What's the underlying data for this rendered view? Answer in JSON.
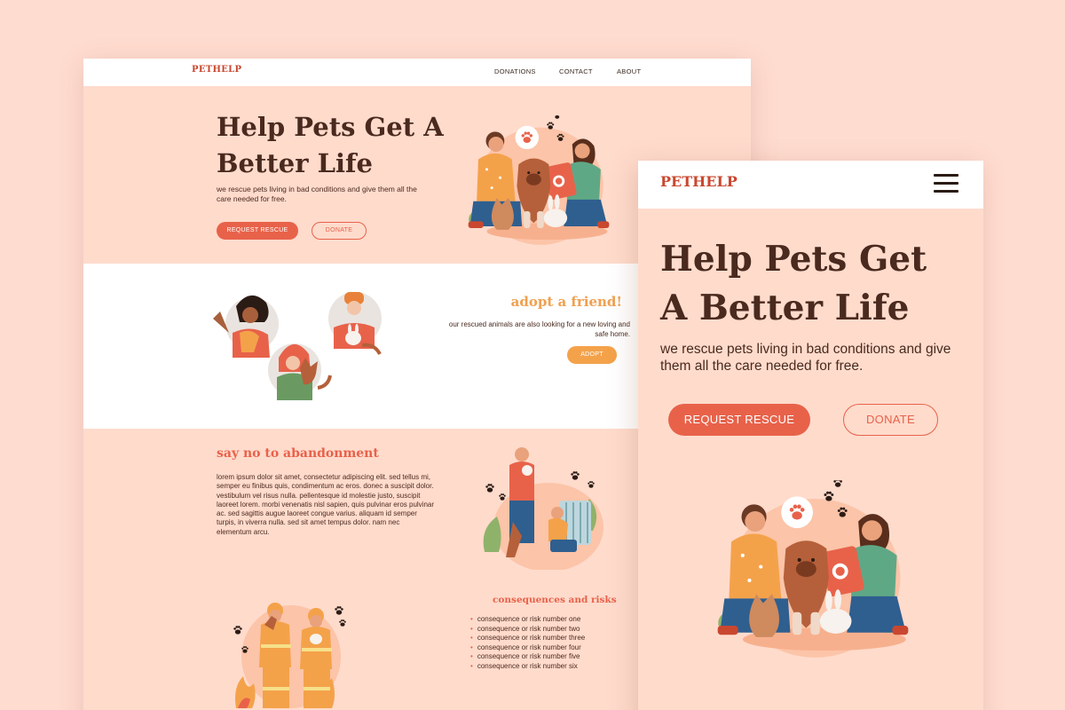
{
  "desktop": {
    "nav": {
      "logo": "PETHELP",
      "items": [
        "DONATIONS",
        "CONTACT",
        "ABOUT"
      ]
    },
    "hero": {
      "title": "Help Pets Get A Better Life",
      "subtitle": "we rescue pets living in bad conditions and give them all the care needed for free.",
      "request_button": "REQUEST RESCUE",
      "donate_button": "DONATE"
    },
    "adopt": {
      "title": "adopt a friend!",
      "subtitle": "our rescued animals are also looking for a new loving and safe home.",
      "button": "ADOPT"
    },
    "abandonment": {
      "title": "say no to abandonment",
      "body": "lorem ipsum dolor sit amet, consectetur adipiscing elit. sed tellus mi, semper eu finibus quis, condimentum ac eros. donec a suscipit dolor. vestibulum vel risus nulla. pellentesque id molestie justo, suscipit laoreet lorem. morbi venenatis nisl sapien, quis pulvinar eros pulvinar ac. sed sagittis augue laoreet congue varius. aliquam id semper turpis, in viverra nulla. sed sit amet tempus dolor. nam nec elementum arcu."
    },
    "consequences": {
      "title": "consequences and risks",
      "items": [
        "consequence or risk number one",
        "consequence or risk number two",
        "consequence or risk number three",
        "consequence or risk number four",
        "consequence or risk number five",
        "consequence or risk number six"
      ]
    }
  },
  "mobile": {
    "logo": "PETHELP",
    "menu_icon": "hamburger-icon",
    "title": "Help Pets Get A Better Life",
    "subtitle": "we rescue pets living in bad conditions and give them all the care needed for free.",
    "request_button": "REQUEST RESCUE",
    "donate_button": "DONATE"
  },
  "colors": {
    "page_bg": "#ffdcd0",
    "section_bg": "#ffdbcc",
    "accent": "#e8624a",
    "adopt_accent": "#f4a24a",
    "heading": "#4a2a1e"
  }
}
